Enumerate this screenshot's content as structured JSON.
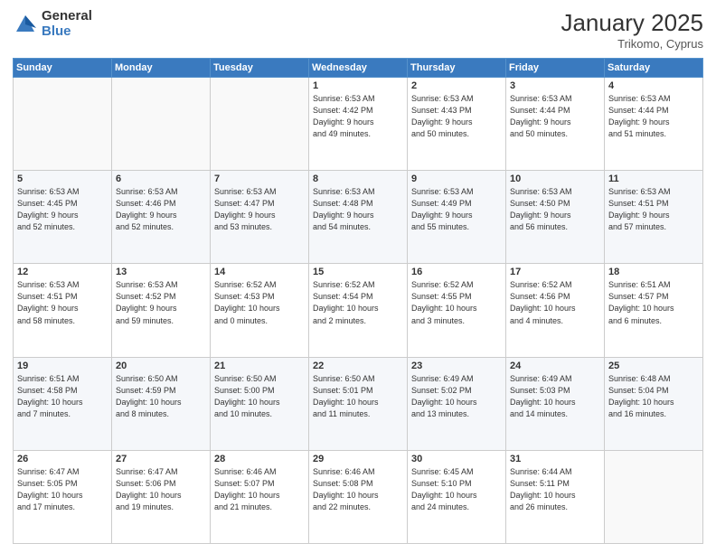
{
  "header": {
    "logo_general": "General",
    "logo_blue": "Blue",
    "month_year": "January 2025",
    "location": "Trikomo, Cyprus"
  },
  "days_of_week": [
    "Sunday",
    "Monday",
    "Tuesday",
    "Wednesday",
    "Thursday",
    "Friday",
    "Saturday"
  ],
  "weeks": [
    [
      {
        "day": "",
        "info": ""
      },
      {
        "day": "",
        "info": ""
      },
      {
        "day": "",
        "info": ""
      },
      {
        "day": "1",
        "info": "Sunrise: 6:53 AM\nSunset: 4:42 PM\nDaylight: 9 hours\nand 49 minutes."
      },
      {
        "day": "2",
        "info": "Sunrise: 6:53 AM\nSunset: 4:43 PM\nDaylight: 9 hours\nand 50 minutes."
      },
      {
        "day": "3",
        "info": "Sunrise: 6:53 AM\nSunset: 4:44 PM\nDaylight: 9 hours\nand 50 minutes."
      },
      {
        "day": "4",
        "info": "Sunrise: 6:53 AM\nSunset: 4:44 PM\nDaylight: 9 hours\nand 51 minutes."
      }
    ],
    [
      {
        "day": "5",
        "info": "Sunrise: 6:53 AM\nSunset: 4:45 PM\nDaylight: 9 hours\nand 52 minutes."
      },
      {
        "day": "6",
        "info": "Sunrise: 6:53 AM\nSunset: 4:46 PM\nDaylight: 9 hours\nand 52 minutes."
      },
      {
        "day": "7",
        "info": "Sunrise: 6:53 AM\nSunset: 4:47 PM\nDaylight: 9 hours\nand 53 minutes."
      },
      {
        "day": "8",
        "info": "Sunrise: 6:53 AM\nSunset: 4:48 PM\nDaylight: 9 hours\nand 54 minutes."
      },
      {
        "day": "9",
        "info": "Sunrise: 6:53 AM\nSunset: 4:49 PM\nDaylight: 9 hours\nand 55 minutes."
      },
      {
        "day": "10",
        "info": "Sunrise: 6:53 AM\nSunset: 4:50 PM\nDaylight: 9 hours\nand 56 minutes."
      },
      {
        "day": "11",
        "info": "Sunrise: 6:53 AM\nSunset: 4:51 PM\nDaylight: 9 hours\nand 57 minutes."
      }
    ],
    [
      {
        "day": "12",
        "info": "Sunrise: 6:53 AM\nSunset: 4:51 PM\nDaylight: 9 hours\nand 58 minutes."
      },
      {
        "day": "13",
        "info": "Sunrise: 6:53 AM\nSunset: 4:52 PM\nDaylight: 9 hours\nand 59 minutes."
      },
      {
        "day": "14",
        "info": "Sunrise: 6:52 AM\nSunset: 4:53 PM\nDaylight: 10 hours\nand 0 minutes."
      },
      {
        "day": "15",
        "info": "Sunrise: 6:52 AM\nSunset: 4:54 PM\nDaylight: 10 hours\nand 2 minutes."
      },
      {
        "day": "16",
        "info": "Sunrise: 6:52 AM\nSunset: 4:55 PM\nDaylight: 10 hours\nand 3 minutes."
      },
      {
        "day": "17",
        "info": "Sunrise: 6:52 AM\nSunset: 4:56 PM\nDaylight: 10 hours\nand 4 minutes."
      },
      {
        "day": "18",
        "info": "Sunrise: 6:51 AM\nSunset: 4:57 PM\nDaylight: 10 hours\nand 6 minutes."
      }
    ],
    [
      {
        "day": "19",
        "info": "Sunrise: 6:51 AM\nSunset: 4:58 PM\nDaylight: 10 hours\nand 7 minutes."
      },
      {
        "day": "20",
        "info": "Sunrise: 6:50 AM\nSunset: 4:59 PM\nDaylight: 10 hours\nand 8 minutes."
      },
      {
        "day": "21",
        "info": "Sunrise: 6:50 AM\nSunset: 5:00 PM\nDaylight: 10 hours\nand 10 minutes."
      },
      {
        "day": "22",
        "info": "Sunrise: 6:50 AM\nSunset: 5:01 PM\nDaylight: 10 hours\nand 11 minutes."
      },
      {
        "day": "23",
        "info": "Sunrise: 6:49 AM\nSunset: 5:02 PM\nDaylight: 10 hours\nand 13 minutes."
      },
      {
        "day": "24",
        "info": "Sunrise: 6:49 AM\nSunset: 5:03 PM\nDaylight: 10 hours\nand 14 minutes."
      },
      {
        "day": "25",
        "info": "Sunrise: 6:48 AM\nSunset: 5:04 PM\nDaylight: 10 hours\nand 16 minutes."
      }
    ],
    [
      {
        "day": "26",
        "info": "Sunrise: 6:47 AM\nSunset: 5:05 PM\nDaylight: 10 hours\nand 17 minutes."
      },
      {
        "day": "27",
        "info": "Sunrise: 6:47 AM\nSunset: 5:06 PM\nDaylight: 10 hours\nand 19 minutes."
      },
      {
        "day": "28",
        "info": "Sunrise: 6:46 AM\nSunset: 5:07 PM\nDaylight: 10 hours\nand 21 minutes."
      },
      {
        "day": "29",
        "info": "Sunrise: 6:46 AM\nSunset: 5:08 PM\nDaylight: 10 hours\nand 22 minutes."
      },
      {
        "day": "30",
        "info": "Sunrise: 6:45 AM\nSunset: 5:10 PM\nDaylight: 10 hours\nand 24 minutes."
      },
      {
        "day": "31",
        "info": "Sunrise: 6:44 AM\nSunset: 5:11 PM\nDaylight: 10 hours\nand 26 minutes."
      },
      {
        "day": "",
        "info": ""
      }
    ]
  ]
}
